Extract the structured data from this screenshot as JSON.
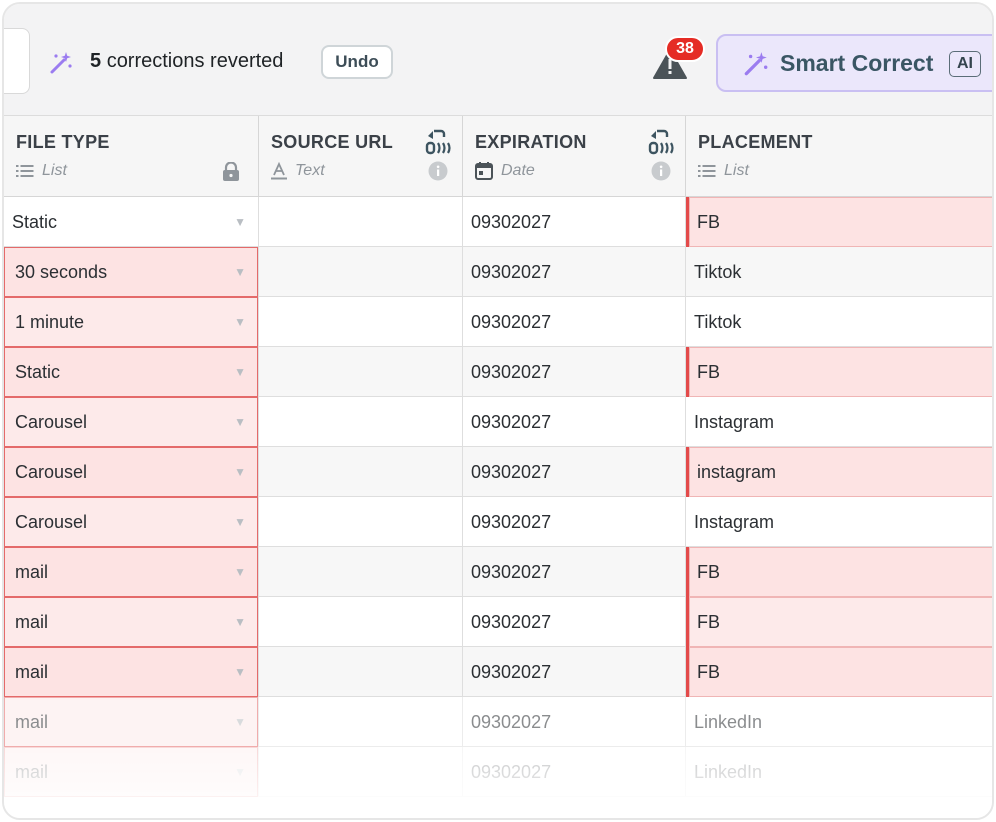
{
  "toolbar": {
    "corrections_count": "5",
    "corrections_text": "corrections reverted",
    "undo_label": "Undo",
    "warning_count": "38",
    "smart_correct_label": "Smart Correct",
    "ai_label": "AI",
    "accent_color": "#c9bff2",
    "badge_color": "#e52c25"
  },
  "columns": [
    {
      "name": "FILE TYPE",
      "type": "List",
      "type_icon": "list-icon",
      "locked": true
    },
    {
      "name": "SOURCE URL",
      "type": "Text",
      "type_icon": "text-icon"
    },
    {
      "name": "EXPIRATION",
      "type": "Date",
      "type_icon": "calendar-icon"
    },
    {
      "name": "PLACEMENT",
      "type": "List",
      "type_icon": "list-icon"
    }
  ],
  "rows": [
    {
      "file_type": "Static",
      "source_url": "",
      "expiration": "09302027",
      "placement": "FB"
    },
    {
      "file_type": "30 seconds",
      "source_url": "",
      "expiration": "09302027",
      "placement": "Tiktok"
    },
    {
      "file_type": "1 minute",
      "source_url": "",
      "expiration": "09302027",
      "placement": "Tiktok"
    },
    {
      "file_type": "Static",
      "source_url": "",
      "expiration": "09302027",
      "placement": "FB"
    },
    {
      "file_type": "Carousel",
      "source_url": "",
      "expiration": "09302027",
      "placement": "Instagram"
    },
    {
      "file_type": "Carousel",
      "source_url": "",
      "expiration": "09302027",
      "placement": "instagram"
    },
    {
      "file_type": "Carousel",
      "source_url": "",
      "expiration": "09302027",
      "placement": "Instagram"
    },
    {
      "file_type": "mail",
      "source_url": "",
      "expiration": "09302027",
      "placement": "FB"
    },
    {
      "file_type": "mail",
      "source_url": "",
      "expiration": "09302027",
      "placement": "FB"
    },
    {
      "file_type": "mail",
      "source_url": "",
      "expiration": "09302027",
      "placement": "FB"
    },
    {
      "file_type": "mail",
      "source_url": "",
      "expiration": "09302027",
      "placement": "LinkedIn"
    },
    {
      "file_type": "mail",
      "source_url": "",
      "expiration": "09302027",
      "placement": "LinkedIn"
    }
  ]
}
